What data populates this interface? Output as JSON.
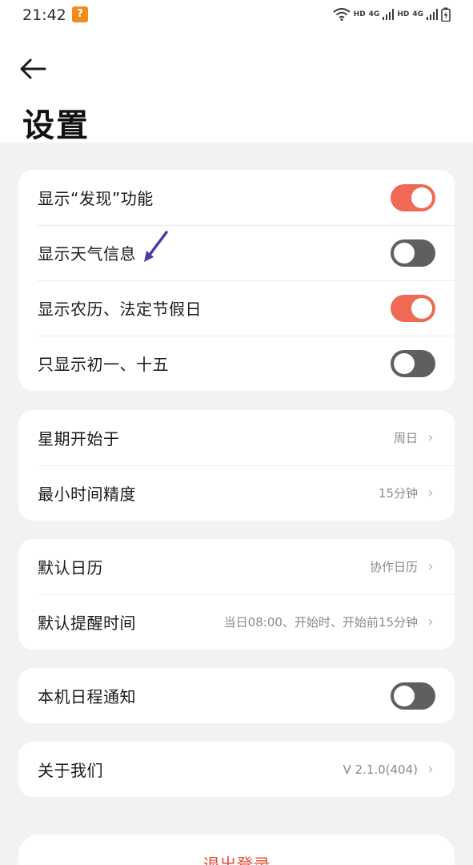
{
  "status_bar": {
    "time": "21:42",
    "notification_badge": "?",
    "network_labels": [
      "HD",
      "4G",
      "HD",
      "4G"
    ]
  },
  "header": {
    "title": "设置"
  },
  "display_section": {
    "items": [
      {
        "label": "显示“发现”功能",
        "enabled": true
      },
      {
        "label": "显示天气信息",
        "enabled": false
      },
      {
        "label": "显示农历、法定节假日",
        "enabled": true
      },
      {
        "label": "只显示初一、十五",
        "enabled": false
      }
    ]
  },
  "time_section": {
    "items": [
      {
        "label": "星期开始于",
        "value": "周日"
      },
      {
        "label": "最小时间精度",
        "value": "15分钟"
      }
    ]
  },
  "default_section": {
    "items": [
      {
        "label": "默认日历",
        "value": "协作日历"
      },
      {
        "label": "默认提醒时间",
        "value": "当日08:00、开始时、开始前15分钟"
      }
    ]
  },
  "notification_section": {
    "label": "本机日程通知",
    "enabled": false
  },
  "about_section": {
    "label": "关于我们",
    "value": "V 2.1.0(404)"
  },
  "logout": {
    "label": "退出登录"
  },
  "colors": {
    "toggle_on": "#ef6a55",
    "toggle_off": "#5f5f5f",
    "logout_text": "#e0543f",
    "annotation_arrow": "#4b3aa8"
  },
  "icons": {
    "back": "arrow-left-icon",
    "chevron": "chevron-right-icon"
  }
}
